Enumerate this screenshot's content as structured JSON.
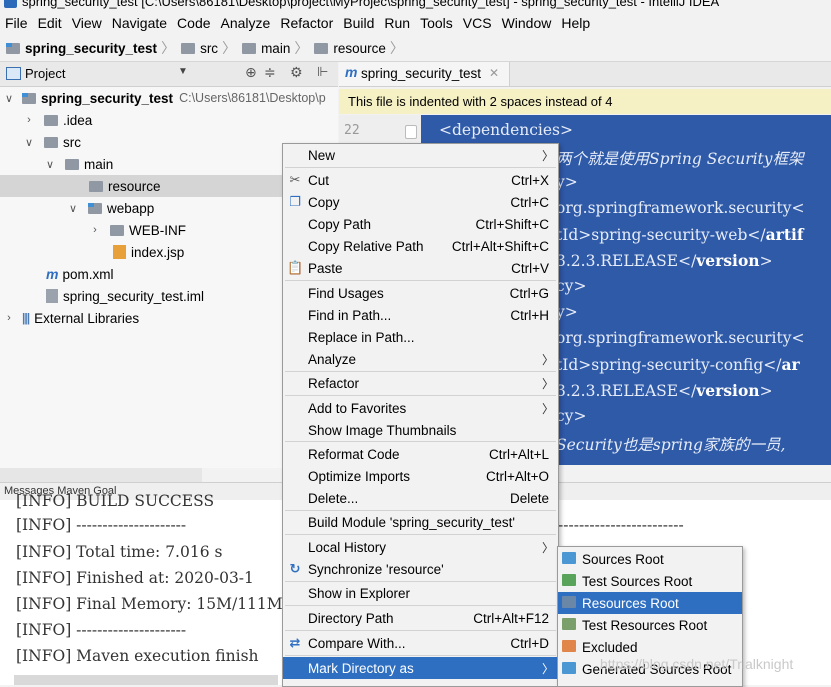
{
  "window": {
    "title": "spring_security_test [C:\\Users\\86181\\Desktop\\project\\MyProjec\\spring_security_test] - spring_security_test - IntelliJ IDEA"
  },
  "menubar": [
    "File",
    "Edit",
    "View",
    "Navigate",
    "Code",
    "Analyze",
    "Refactor",
    "Build",
    "Run",
    "Tools",
    "VCS",
    "Window",
    "Help"
  ],
  "breadcrumb": [
    "spring_security_test",
    "src",
    "main",
    "resource"
  ],
  "project_panel": {
    "title": "Project",
    "root_label": "spring_security_test",
    "root_path": "C:\\Users\\86181\\Desktop\\p",
    "items": {
      "idea": ".idea",
      "src": "src",
      "main": "main",
      "resource": "resource",
      "webapp": "webapp",
      "webinf": "WEB-INF",
      "indexjsp": "index.jsp",
      "pom": "pom.xml",
      "iml": "spring_security_test.iml",
      "extlib": "External Libraries"
    }
  },
  "editor": {
    "tab_label": "spring_security_test",
    "notice": "This file is indented with 2 spaces instead of 4",
    "line_number": "22",
    "lines": {
      "l1": "<dependencies>",
      "l2": "两个就是使用Spring Security框架",
      "l3": "y>",
      "l4": "org.springframework.security<",
      "l5a": "tId>spring-security-web</",
      "l5b": "artif",
      "l6a": "3.2.3.RELEASE</",
      "l6b": "version",
      "l6c": ">",
      "l7": "cy>",
      "l8": "y>",
      "l9": "org.springframework.security<",
      "l10a": "tId>spring-security-config</",
      "l10b": "ar",
      "l11a": "3.2.3.RELEASE</",
      "l11b": "version",
      "l11c": ">",
      "l12": "cy>",
      "l13": "Security也是spring家族的一员,"
    }
  },
  "messages": {
    "title": "Messages Maven Goal",
    "lines": {
      "c0": "[INFO] BUILD SUCCESS",
      "c1": "[INFO] ---------------------",
      "c1r": "------------------------",
      "c2": "[INFO] Total time: 7.016 s",
      "c3": "[INFO] Finished at: 2020-03-1",
      "c4": "[INFO] Final Memory: 15M/111M",
      "c5": "[INFO] ---------------------",
      "c6": "[INFO] Maven execution finish"
    }
  },
  "context_menu": {
    "new": "New",
    "cut": "Cut",
    "cut_sc": "Ctrl+X",
    "copy": "Copy",
    "copy_sc": "Ctrl+C",
    "copy_path": "Copy Path",
    "copy_path_sc": "Ctrl+Shift+C",
    "copy_rel": "Copy Relative Path",
    "copy_rel_sc": "Ctrl+Alt+Shift+C",
    "paste": "Paste",
    "paste_sc": "Ctrl+V",
    "find_usages": "Find Usages",
    "find_usages_sc": "Ctrl+G",
    "find_in_path": "Find in Path...",
    "find_in_path_sc": "Ctrl+H",
    "replace_in_path": "Replace in Path...",
    "analyze": "Analyze",
    "refactor": "Refactor",
    "add_fav": "Add to Favorites",
    "show_thumbs": "Show Image Thumbnails",
    "reformat": "Reformat Code",
    "reformat_sc": "Ctrl+Alt+L",
    "optimize": "Optimize Imports",
    "optimize_sc": "Ctrl+Alt+O",
    "delete": "Delete...",
    "delete_sc": "Delete",
    "build_module": "Build Module 'spring_security_test'",
    "local_history": "Local History",
    "sync": "Synchronize 'resource'",
    "show_explorer": "Show in Explorer",
    "dir_path": "Directory Path",
    "dir_path_sc": "Ctrl+Alt+F12",
    "compare": "Compare With...",
    "compare_sc": "Ctrl+D",
    "mark_dir": "Mark Directory as"
  },
  "submenu": {
    "sources_root": "Sources Root",
    "test_sources_root": "Test Sources Root",
    "resources_root": "Resources Root",
    "test_resources_root": "Test Resources Root",
    "excluded": "Excluded",
    "generated_sources_root": "Generated Sources Root"
  },
  "watermark": "https://blog.csdn.net/Trialknight",
  "colors": {
    "selection": "#2f6fc2",
    "editor_bg": "#2f5aa8",
    "notice_bg": "#f5f1c4",
    "sources_root": "#4a97d4",
    "test_sources_root": "#5aa35a",
    "resources_root": "#6b87a8",
    "excluded": "#e0864a"
  }
}
